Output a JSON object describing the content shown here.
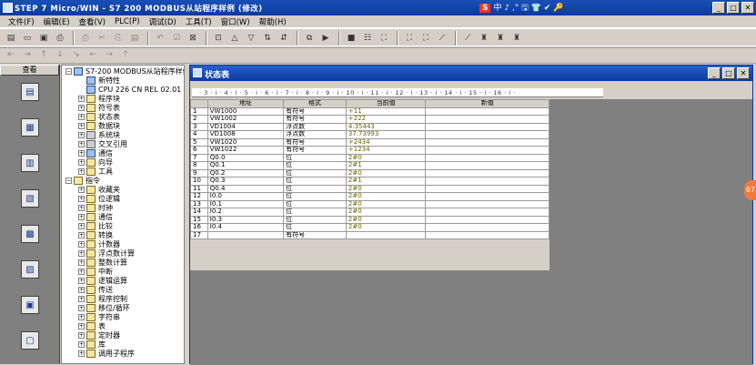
{
  "window": {
    "title": "STEP 7 Micro/WIN - S7 200 MODBUS从站程序样例 (修改)",
    "min": "_",
    "max": "□",
    "close": "✕"
  },
  "ime": {
    "logo": "S",
    "text": "中 ♪ ,° 🖫 👕 ✔ 🔑"
  },
  "menu": [
    "文件(F)",
    "编辑(E)",
    "查看(V)",
    "PLC(P)",
    "调试(D)",
    "工具(T)",
    "窗口(W)",
    "帮助(H)"
  ],
  "toolbar1": [
    "▤",
    "▭",
    "▣",
    "⎙",
    "⎙",
    "✂",
    "⎘",
    "▤",
    "↶",
    "☑",
    "⊠",
    "⊡",
    "△",
    "▽",
    "⇅",
    "⇵",
    "⧉",
    "▶",
    "■",
    "☷",
    "⛶",
    "⛶",
    "⛶",
    "⟋",
    "⟋",
    "♜",
    "♜",
    "♜"
  ],
  "toolbar2": [
    "⇤",
    "⇥",
    "↑",
    "↓",
    "↘",
    "←",
    "→",
    "⇡"
  ],
  "nav": {
    "header": "查看",
    "items": [
      "程序块",
      "符号表",
      "状态表",
      "数据块",
      "系统块",
      "交叉引用",
      "通信",
      "设置 PG/PC 接口"
    ]
  },
  "tree": {
    "items": [
      {
        "label": "S7-200 MODBUS从站程序样例",
        "lvl": 0,
        "pm": "−",
        "icon": "b"
      },
      {
        "label": "新特性",
        "lvl": 1,
        "pm": "",
        "icon": "b"
      },
      {
        "label": "CPU 226 CN REL 02.01",
        "lvl": 1,
        "pm": "",
        "icon": "b"
      },
      {
        "label": "程序块",
        "lvl": 1,
        "pm": "+",
        "icon": ""
      },
      {
        "label": "符号表",
        "lvl": 1,
        "pm": "+",
        "icon": ""
      },
      {
        "label": "状态表",
        "lvl": 1,
        "pm": "+",
        "icon": ""
      },
      {
        "label": "数据块",
        "lvl": 1,
        "pm": "+",
        "icon": ""
      },
      {
        "label": "系统块",
        "lvl": 1,
        "pm": "+",
        "icon": "g"
      },
      {
        "label": "交叉引用",
        "lvl": 1,
        "pm": "+",
        "icon": "g"
      },
      {
        "label": "通信",
        "lvl": 1,
        "pm": "+",
        "icon": "b"
      },
      {
        "label": "向导",
        "lvl": 1,
        "pm": "+",
        "icon": ""
      },
      {
        "label": "工具",
        "lvl": 1,
        "pm": "+",
        "icon": ""
      },
      {
        "label": "指令",
        "lvl": 0,
        "pm": "−",
        "icon": ""
      },
      {
        "label": "收藏夹",
        "lvl": 1,
        "pm": "+",
        "icon": ""
      },
      {
        "label": "位逻辑",
        "lvl": 1,
        "pm": "+",
        "icon": ""
      },
      {
        "label": "时钟",
        "lvl": 1,
        "pm": "+",
        "icon": ""
      },
      {
        "label": "通信",
        "lvl": 1,
        "pm": "+",
        "icon": ""
      },
      {
        "label": "比较",
        "lvl": 1,
        "pm": "+",
        "icon": ""
      },
      {
        "label": "转换",
        "lvl": 1,
        "pm": "+",
        "icon": ""
      },
      {
        "label": "计数器",
        "lvl": 1,
        "pm": "+",
        "icon": ""
      },
      {
        "label": "浮点数计算",
        "lvl": 1,
        "pm": "+",
        "icon": ""
      },
      {
        "label": "整数计算",
        "lvl": 1,
        "pm": "+",
        "icon": ""
      },
      {
        "label": "中断",
        "lvl": 1,
        "pm": "+",
        "icon": ""
      },
      {
        "label": "逻辑运算",
        "lvl": 1,
        "pm": "+",
        "icon": ""
      },
      {
        "label": "传送",
        "lvl": 1,
        "pm": "+",
        "icon": ""
      },
      {
        "label": "程序控制",
        "lvl": 1,
        "pm": "+",
        "icon": ""
      },
      {
        "label": "移位/循环",
        "lvl": 1,
        "pm": "+",
        "icon": ""
      },
      {
        "label": "字符串",
        "lvl": 1,
        "pm": "+",
        "icon": ""
      },
      {
        "label": "表",
        "lvl": 1,
        "pm": "+",
        "icon": ""
      },
      {
        "label": "定时器",
        "lvl": 1,
        "pm": "+",
        "icon": ""
      },
      {
        "label": "库",
        "lvl": 1,
        "pm": "+",
        "icon": ""
      },
      {
        "label": "调用子程序",
        "lvl": 1,
        "pm": "+",
        "icon": ""
      }
    ]
  },
  "status_table": {
    "title": "状态表",
    "ruler": "· 3 · i · 4 · i · 5 · i · 6 · i · 7 · i · 8 · i · 9 · i · 10 · i · 11 · i · 12 · i · 13 · i · 14 · i · 15 · i · 16 · i ·",
    "headers": [
      "",
      "地址",
      "格式",
      "当前值",
      "新值"
    ],
    "rows": [
      [
        "1",
        "VW1000",
        "有符号",
        "+11",
        ""
      ],
      [
        "2",
        "VW1002",
        "有符号",
        "+222",
        ""
      ],
      [
        "3",
        "VD1004",
        "浮点数",
        "4.35443",
        ""
      ],
      [
        "4",
        "VD1008",
        "浮点数",
        "37.73993",
        ""
      ],
      [
        "5",
        "VW1020",
        "有符号",
        "+2434",
        ""
      ],
      [
        "6",
        "VW1022",
        "有符号",
        "+1234",
        ""
      ],
      [
        "7",
        "Q0.0",
        "位",
        "2#0",
        ""
      ],
      [
        "8",
        "Q0.1",
        "位",
        "2#1",
        ""
      ],
      [
        "9",
        "Q0.2",
        "位",
        "2#0",
        ""
      ],
      [
        "10",
        "Q0.3",
        "位",
        "2#1",
        ""
      ],
      [
        "11",
        "Q0.4",
        "位",
        "2#0",
        ""
      ],
      [
        "12",
        "I0.0",
        "位",
        "2#0",
        ""
      ],
      [
        "13",
        "I0.1",
        "位",
        "2#0",
        ""
      ],
      [
        "14",
        "I0.2",
        "位",
        "2#0",
        ""
      ],
      [
        "15",
        "I0.3",
        "位",
        "2#0",
        ""
      ],
      [
        "16",
        "I0.4",
        "位",
        "2#0",
        ""
      ],
      [
        "17",
        "",
        "有符号",
        "",
        ""
      ]
    ]
  },
  "badge": "67"
}
